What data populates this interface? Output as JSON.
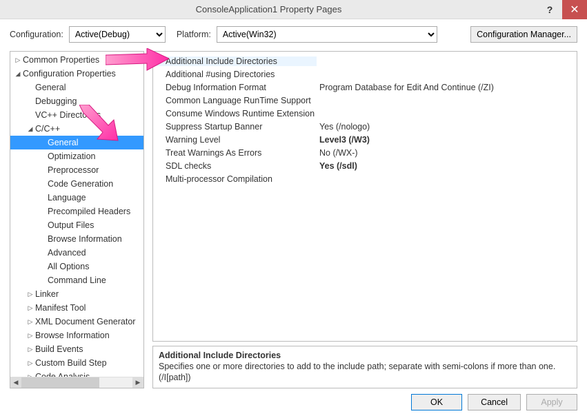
{
  "title": "ConsoleApplication1 Property Pages",
  "config": {
    "label": "Configuration:",
    "value": "Active(Debug)",
    "platform_label": "Platform:",
    "platform_value": "Active(Win32)",
    "manager_btn": "Configuration Manager..."
  },
  "tree": [
    {
      "label": "Common Properties",
      "indent": 1,
      "arrow": "closed"
    },
    {
      "label": "Configuration Properties",
      "indent": 1,
      "arrow": "open"
    },
    {
      "label": "General",
      "indent": 2,
      "arrow": "none"
    },
    {
      "label": "Debugging",
      "indent": 2,
      "arrow": "none"
    },
    {
      "label": "VC++ Directories",
      "indent": 2,
      "arrow": "none"
    },
    {
      "label": "C/C++",
      "indent": 2,
      "arrow": "open"
    },
    {
      "label": "General",
      "indent": 3,
      "arrow": "none",
      "selected": true
    },
    {
      "label": "Optimization",
      "indent": 3,
      "arrow": "none"
    },
    {
      "label": "Preprocessor",
      "indent": 3,
      "arrow": "none"
    },
    {
      "label": "Code Generation",
      "indent": 3,
      "arrow": "none"
    },
    {
      "label": "Language",
      "indent": 3,
      "arrow": "none"
    },
    {
      "label": "Precompiled Headers",
      "indent": 3,
      "arrow": "none"
    },
    {
      "label": "Output Files",
      "indent": 3,
      "arrow": "none"
    },
    {
      "label": "Browse Information",
      "indent": 3,
      "arrow": "none"
    },
    {
      "label": "Advanced",
      "indent": 3,
      "arrow": "none"
    },
    {
      "label": "All Options",
      "indent": 3,
      "arrow": "none"
    },
    {
      "label": "Command Line",
      "indent": 3,
      "arrow": "none"
    },
    {
      "label": "Linker",
      "indent": 2,
      "arrow": "closed"
    },
    {
      "label": "Manifest Tool",
      "indent": 2,
      "arrow": "closed"
    },
    {
      "label": "XML Document Generator",
      "indent": 2,
      "arrow": "closed"
    },
    {
      "label": "Browse Information",
      "indent": 2,
      "arrow": "closed"
    },
    {
      "label": "Build Events",
      "indent": 2,
      "arrow": "closed"
    },
    {
      "label": "Custom Build Step",
      "indent": 2,
      "arrow": "closed"
    },
    {
      "label": "Code Analysis",
      "indent": 2,
      "arrow": "closed"
    }
  ],
  "props": [
    {
      "name": "Additional Include Directories",
      "value": "",
      "first": true
    },
    {
      "name": "Additional #using Directories",
      "value": ""
    },
    {
      "name": "Debug Information Format",
      "value": "Program Database for Edit And Continue (/ZI)"
    },
    {
      "name": "Common Language RunTime Support",
      "value": ""
    },
    {
      "name": "Consume Windows Runtime Extension",
      "value": ""
    },
    {
      "name": "Suppress Startup Banner",
      "value": "Yes (/nologo)"
    },
    {
      "name": "Warning Level",
      "value": "Level3 (/W3)",
      "bold": true
    },
    {
      "name": "Treat Warnings As Errors",
      "value": "No (/WX-)"
    },
    {
      "name": "SDL checks",
      "value": "Yes (/sdl)",
      "bold": true
    },
    {
      "name": "Multi-processor Compilation",
      "value": ""
    }
  ],
  "desc": {
    "title": "Additional Include Directories",
    "text": "Specifies one or more directories to add to the include path; separate with semi-colons if more than one. (/I[path])"
  },
  "buttons": {
    "ok": "OK",
    "cancel": "Cancel",
    "apply": "Apply"
  }
}
